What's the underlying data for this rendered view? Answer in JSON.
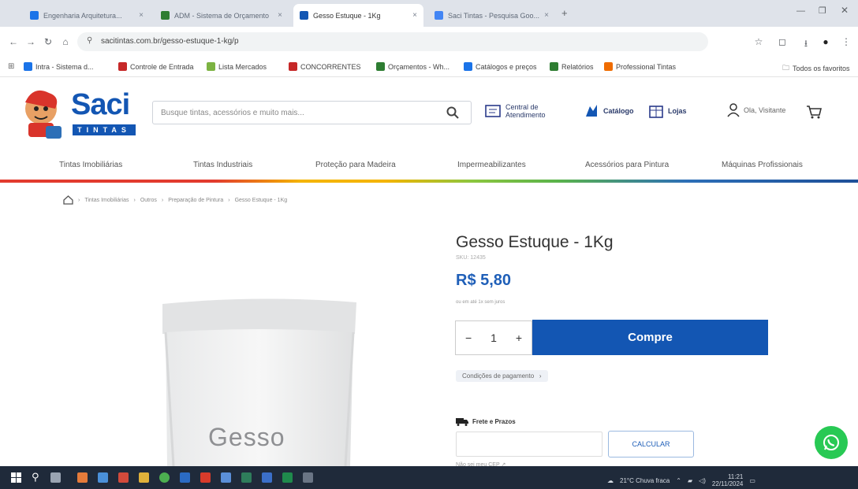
{
  "browser": {
    "tabs": [
      {
        "label": "Engenharia Arquitetura...",
        "color": "#1a73e8"
      },
      {
        "label": "ADM - Sistema de Orçamento",
        "color": "#2e7d32"
      },
      {
        "label": "Gesso Estuque - 1Kg",
        "color": "#1356b3"
      },
      {
        "label": "Saci Tintas - Pesquisa Goo...",
        "color": "#4285f4"
      }
    ],
    "url": "sacitintas.com.br/gesso-estuque-1-kg/p",
    "bookmarks": [
      {
        "label": "Intra - Sistema d...",
        "color": "#1a73e8"
      },
      {
        "label": "Controle de Entrada",
        "color": "#c62828"
      },
      {
        "label": "Lista Mercados",
        "color": "#7cb342"
      },
      {
        "label": "CONCORRENTES",
        "color": "#c62828"
      },
      {
        "label": "Orçamentos - Wh...",
        "color": "#2e7d32"
      },
      {
        "label": "Catálogos e preços",
        "color": "#1a73e8"
      },
      {
        "label": "Relatórios",
        "color": "#2e7d32"
      },
      {
        "label": "Professional Tintas",
        "color": "#ef6c00"
      }
    ],
    "all_bookmarks": "Todos os favoritos"
  },
  "header": {
    "logo_text": "Saci",
    "logo_sub": "TINTAS",
    "search_placeholder": "Busque tintas, acessórios e muito mais...",
    "service_label": "Central de Atendimento",
    "catalog_label": "Catálogo",
    "stores_label": "Lojas",
    "account_label": "Ola, Visitante"
  },
  "nav": {
    "items": [
      "Tintas Imobiliárias",
      "Tintas Industriais",
      "Proteção para Madeira",
      "Impermeabilizantes",
      "Acessórios para Pintura",
      "Máquinas Profissionais"
    ]
  },
  "breadcrumb": [
    "Tintas Imobiliárias",
    "Outros",
    "Preparação de Pintura",
    "Gesso Estuque - 1Kg"
  ],
  "product": {
    "title": "Gesso Estuque - 1Kg",
    "sku": "SKU: 12435",
    "price": "R$ 5,80",
    "installments": "ou em até 1x sem juros",
    "quantity": "1",
    "buy_label": "Compre",
    "payment_conditions": "Condições de pagamento",
    "shipping_label": "Frete e Prazos",
    "calc_label": "CALCULAR",
    "no_cep": "Não sei meu CEP",
    "bag_label": "Gesso"
  },
  "taskbar": {
    "weather": "21°C  Chuva fraca",
    "time": "11:21",
    "date": "22/11/2024"
  },
  "colors": {
    "brand_blue": "#1356b3",
    "whatsapp": "#28c954"
  }
}
